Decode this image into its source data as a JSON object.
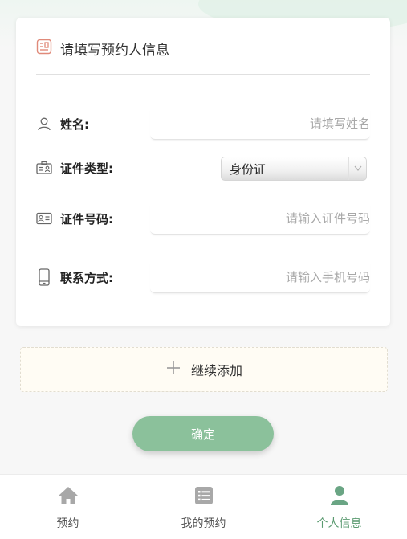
{
  "form": {
    "title": "请填写预约人信息",
    "fields": {
      "name": {
        "label": "姓名:",
        "placeholder": "请填写姓名",
        "value": ""
      },
      "id_type": {
        "label": "证件类型:",
        "selected": "身份证"
      },
      "id_number": {
        "label": "证件号码:",
        "placeholder": "请输入证件号码",
        "value": ""
      },
      "phone": {
        "label": "联系方式:",
        "placeholder": "请输入手机号码",
        "value": ""
      }
    }
  },
  "add": {
    "label": "继续添加"
  },
  "confirm": {
    "label": "确定"
  },
  "tabs": [
    {
      "label": "预约",
      "icon": "home-icon",
      "active": false
    },
    {
      "label": "我的预约",
      "icon": "list-icon",
      "active": false
    },
    {
      "label": "个人信息",
      "icon": "user-icon",
      "active": true
    }
  ],
  "colors": {
    "accent": "#8bc19b",
    "active_tab": "#5a9a70",
    "header_icon": "#e08a7a"
  }
}
